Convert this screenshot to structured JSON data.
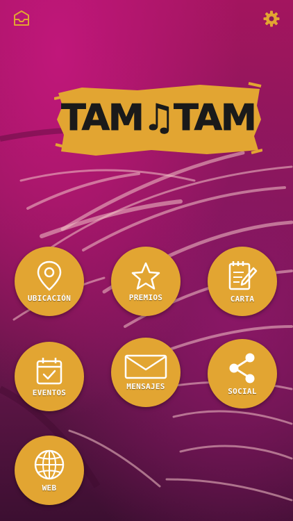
{
  "header": {
    "inbox_icon": "inbox-icon",
    "settings_icon": "gear-icon"
  },
  "logo": {
    "text": "TAM♫TAM"
  },
  "menu": [
    {
      "label": "UBICACIÓN",
      "icon": "map-pin-icon"
    },
    {
      "label": "PREMIOS",
      "icon": "star-icon"
    },
    {
      "label": "CARTA",
      "icon": "notepad-icon"
    },
    {
      "label": "EVENTOS",
      "icon": "calendar-icon"
    },
    {
      "label": "MENSAJES",
      "icon": "envelope-icon"
    },
    {
      "label": "SOCIAL",
      "icon": "share-icon"
    },
    {
      "label": "WEB",
      "icon": "globe-icon"
    }
  ],
  "colors": {
    "accent": "#e2a532",
    "background": "#8b1758"
  }
}
